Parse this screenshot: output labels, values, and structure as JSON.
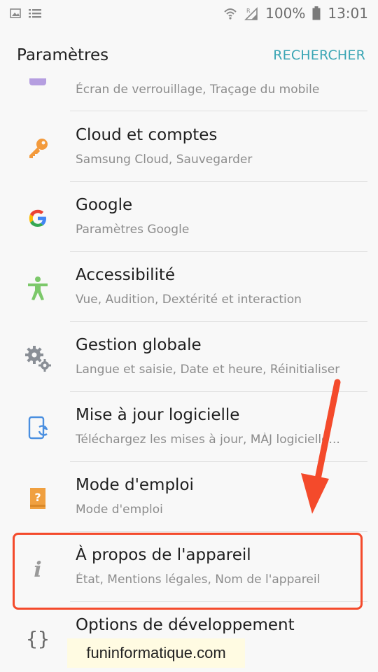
{
  "status_bar": {
    "battery": "100%",
    "time": "13:01",
    "icons": [
      "image-notification-icon",
      "list-notification-icon",
      "wifi-icon",
      "signal-icon",
      "battery-icon"
    ]
  },
  "header": {
    "title": "Paramètres",
    "search_label": "RECHERCHER",
    "accent_color": "#3aa5b4"
  },
  "partial_item": {
    "subtitle": "Écran de verrouillage, Traçage du mobile"
  },
  "items": [
    {
      "title": "Cloud et comptes",
      "subtitle": "Samsung Cloud, Sauvegarder",
      "icon": "key-icon"
    },
    {
      "title": "Google",
      "subtitle": "Paramètres Google",
      "icon": "google-icon"
    },
    {
      "title": "Accessibilité",
      "subtitle": "Vue, Audition, Dextérité et interaction",
      "icon": "accessibility-icon"
    },
    {
      "title": "Gestion globale",
      "subtitle": "Langue et saisie, Date et heure, Réinitialiser",
      "icon": "gears-icon"
    },
    {
      "title": "Mise à jour logicielle",
      "subtitle": "Téléchargez les mises à jour, MÀJ logicielle...",
      "icon": "software-update-icon"
    },
    {
      "title": "Mode d'emploi",
      "subtitle": "Mode d'emploi",
      "icon": "user-manual-icon"
    },
    {
      "title": "À propos de l'appareil",
      "subtitle": "État, Mentions légales, Nom de l'appareil",
      "icon": "info-icon"
    },
    {
      "title": "Options de développement",
      "subtitle": "",
      "icon": "developer-braces-icon"
    }
  ],
  "annotation": {
    "highlight_color": "#f44a2b"
  },
  "watermark": "funinformatique.com"
}
